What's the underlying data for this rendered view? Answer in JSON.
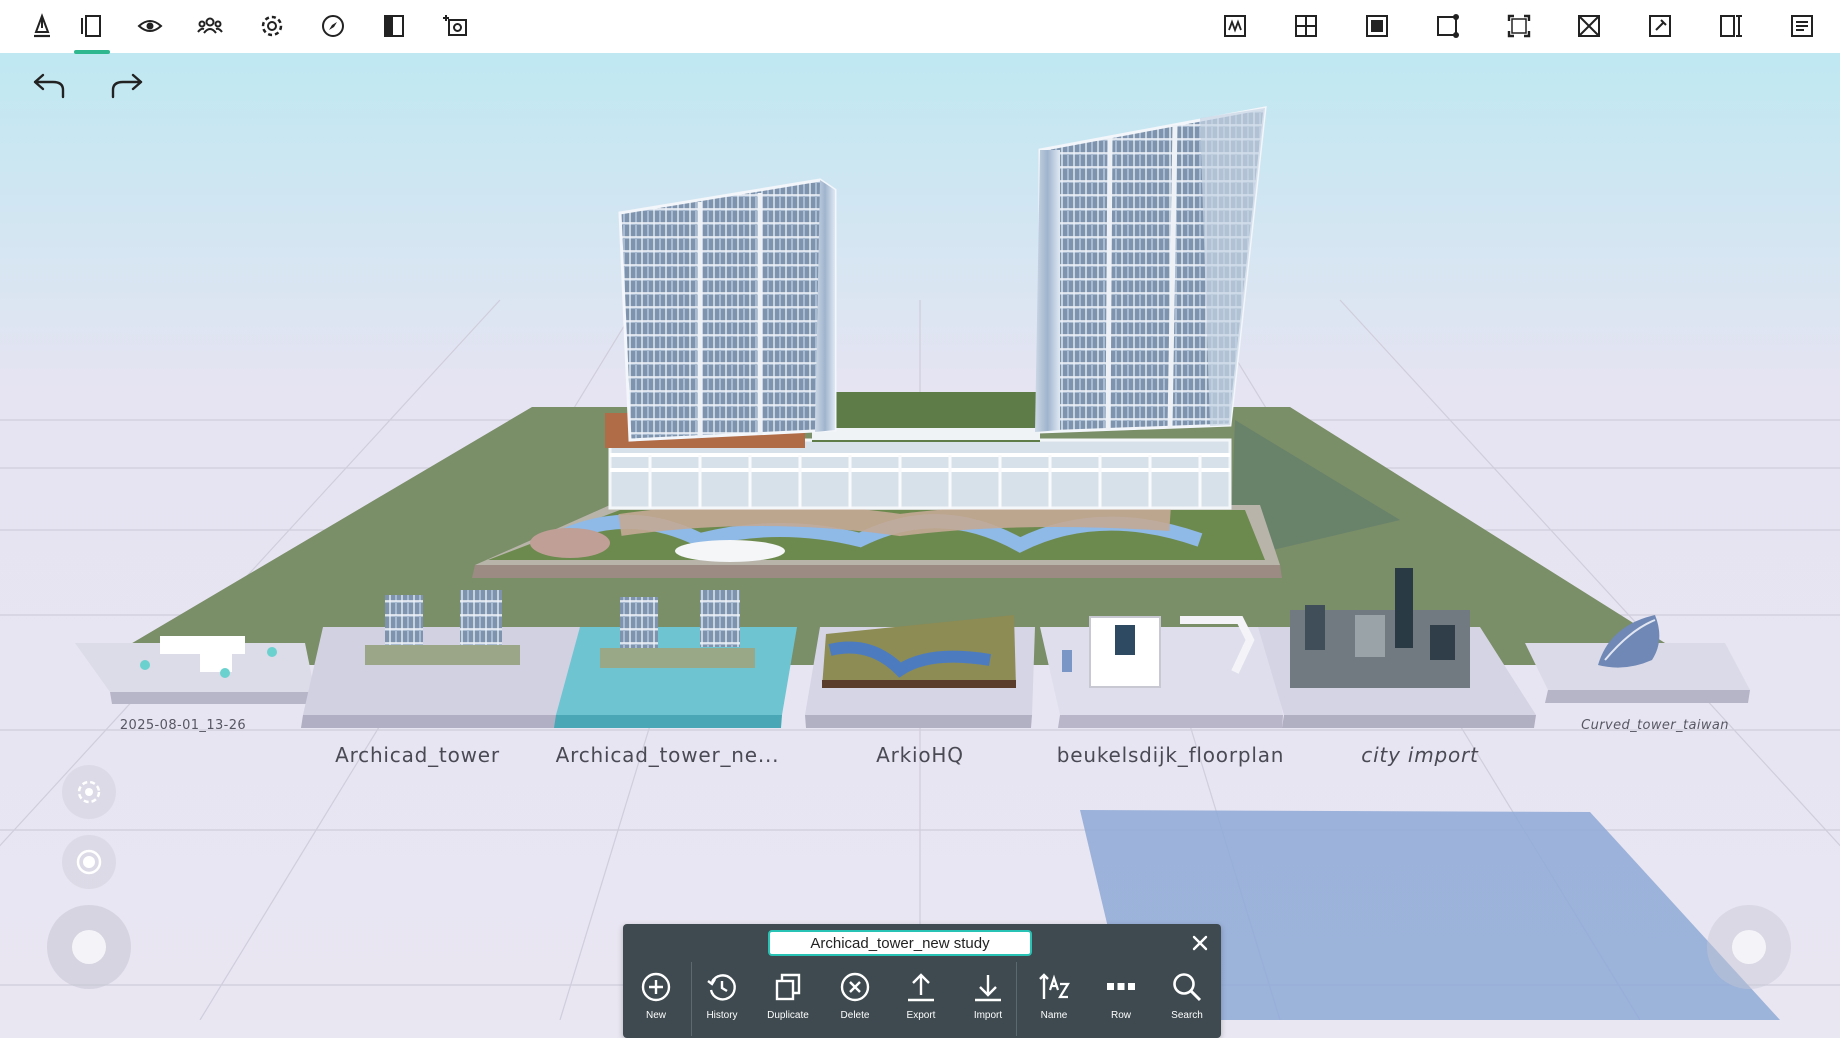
{
  "toolbar": {
    "left_tools": [
      {
        "icon": "pencil-ruler-icon"
      },
      {
        "icon": "projects-panel-icon",
        "active": true
      },
      {
        "icon": "eye-icon"
      },
      {
        "icon": "collaborators-icon"
      },
      {
        "icon": "settings-gear-icon"
      },
      {
        "icon": "compass-icon"
      },
      {
        "icon": "section-plane-icon"
      },
      {
        "icon": "camera-add-icon"
      }
    ],
    "right_tools": [
      {
        "icon": "sketch-texture-icon"
      },
      {
        "icon": "grid-plane-icon"
      },
      {
        "icon": "solid-square-icon"
      },
      {
        "icon": "resize-corner-icon"
      },
      {
        "icon": "fit-view-icon"
      },
      {
        "icon": "cross-square-icon"
      },
      {
        "icon": "pin-square-icon"
      },
      {
        "icon": "split-view-icon"
      },
      {
        "icon": "notes-list-icon"
      }
    ],
    "active_color": "#2fb78f"
  },
  "history": {
    "undo_icon": "undo-arrow-icon",
    "redo_icon": "redo-arrow-icon"
  },
  "projects": [
    {
      "label": "2025-08-01_13-26",
      "style": "small"
    },
    {
      "label": "Archicad_tower",
      "style": "normal"
    },
    {
      "label": "Archicad_tower_ne...",
      "style": "normal",
      "selected": true
    },
    {
      "label": "ArkioHQ",
      "style": "normal"
    },
    {
      "label": "beukelsdijk_floorplan",
      "style": "normal"
    },
    {
      "label": "city import",
      "style": "italic"
    },
    {
      "label": "Curved_tower_taiwan",
      "style": "small-italic"
    }
  ],
  "selected_tile_color": "#6fc4d2",
  "navigation": {
    "rotate_icon": "orbit-rotate-icon",
    "target_icon": "focus-target-icon",
    "left_joystick": "move-joystick",
    "right_joystick": "look-joystick"
  },
  "file_panel": {
    "name_value": "Archicad_tower_new study",
    "close_icon": "close-icon",
    "buttons": [
      {
        "label": "New",
        "icon": "plus-circle-icon"
      },
      {
        "label": "History",
        "icon": "history-clock-icon"
      },
      {
        "label": "Duplicate",
        "icon": "duplicate-icon"
      },
      {
        "label": "Delete",
        "icon": "delete-circle-icon"
      },
      {
        "label": "Export",
        "icon": "export-arrow-icon"
      },
      {
        "label": "Import",
        "icon": "import-arrow-icon"
      },
      {
        "label": "Name",
        "icon": "sort-name-az-icon"
      },
      {
        "label": "Row",
        "icon": "row-dots-icon"
      },
      {
        "label": "Search",
        "icon": "search-icon"
      }
    ]
  }
}
